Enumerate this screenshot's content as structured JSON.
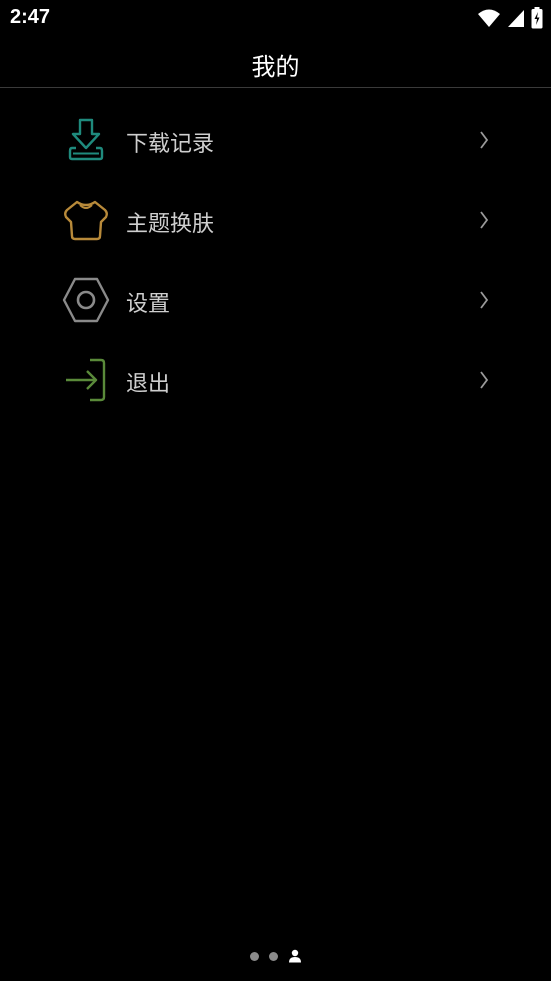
{
  "status_bar": {
    "time": "2:47",
    "icons": [
      "wifi-icon",
      "signal-icon",
      "battery-charging-icon"
    ]
  },
  "header": {
    "title": "我的"
  },
  "menu": {
    "items": [
      {
        "label": "下载记录",
        "icon": "download-icon",
        "color": "#1f8a7d"
      },
      {
        "label": "主题换肤",
        "icon": "shirt-icon",
        "color": "#b88a3a"
      },
      {
        "label": "设置",
        "icon": "hex-nut-settings-icon",
        "color": "#8a8a8a"
      },
      {
        "label": "退出",
        "icon": "logout-icon",
        "color": "#5a8a3a"
      }
    ]
  },
  "pager": {
    "icons": [
      "page-dot-icon",
      "page-dot-icon",
      "person-icon"
    ]
  }
}
